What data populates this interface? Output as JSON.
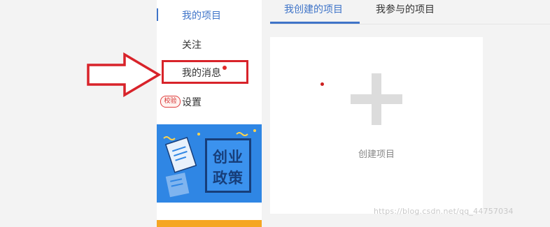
{
  "menu": {
    "items": [
      {
        "label": "我的项目",
        "active": true
      },
      {
        "label": "关注"
      },
      {
        "label": "我的消息",
        "has_notification_dot": true
      },
      {
        "label": "设置",
        "badge": "校验"
      }
    ]
  },
  "banner": {
    "line1": "创业",
    "line2": "政策"
  },
  "tabs": [
    {
      "label": "我创建的项目",
      "active": true
    },
    {
      "label": "我参与的项目"
    }
  ],
  "create_card": {
    "label": "创建项目",
    "icon": "plus-icon"
  },
  "annotation": {
    "arrow_color": "#d8232a",
    "highlight_target": "我的消息"
  },
  "watermark": "https://blog.csdn.net/qq_44757034",
  "colors": {
    "accent": "#3f74c8",
    "alert": "#d8232a",
    "banner": "#2f86e4"
  }
}
